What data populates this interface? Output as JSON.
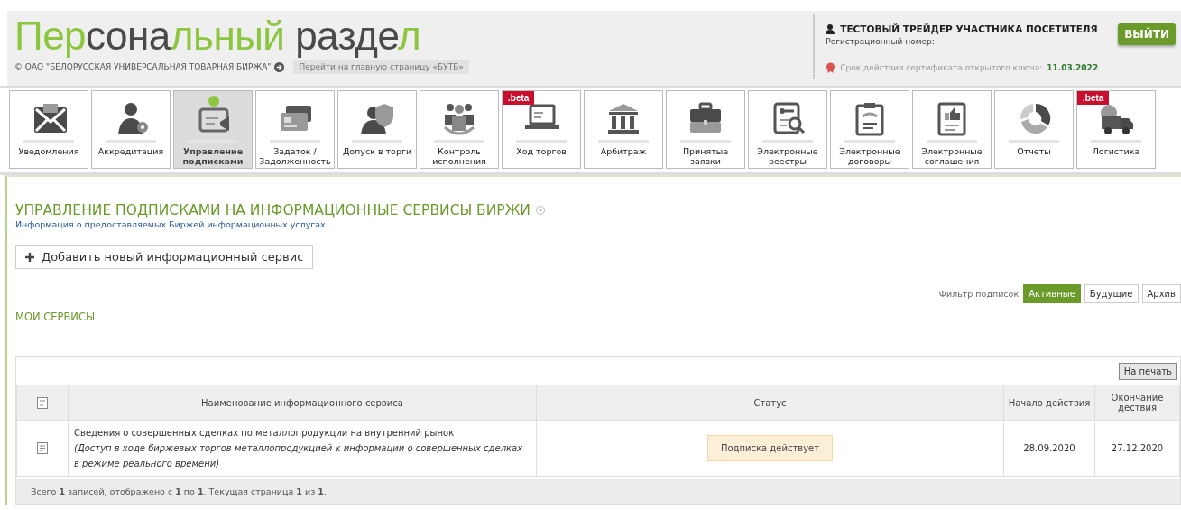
{
  "header": {
    "title": [
      {
        "text": "Пер",
        "accent": true
      },
      {
        "text": "сона",
        "accent": false
      },
      {
        "text": "льный",
        "accent": true
      },
      {
        "text": " разде",
        "accent": false
      },
      {
        "text": "л",
        "accent": true
      }
    ],
    "copyright": "© ОАО \"БЕЛОРУССКАЯ УНИВЕРСАЛЬНАЯ ТОВАРНАЯ БИРЖА\"",
    "home_link": "Перейти на главную страницу «БУТБ»"
  },
  "user": {
    "name": "ТЕСТОВЫЙ ТРЕЙДЕР УЧАСТНИКА ПОСЕТИТЕЛЯ",
    "reg_label": "Регистрационный номер:",
    "cert_label": "Срок действия сертификата открытого ключа:",
    "cert_date": "11.03.2022",
    "logout": "ВЫЙТИ"
  },
  "nav": [
    {
      "label": "Уведомления",
      "selected": false
    },
    {
      "label": "Аккредитация",
      "selected": false
    },
    {
      "label": "Управление подписками",
      "selected": true
    },
    {
      "label": "Задаток / Задолженность",
      "selected": false
    },
    {
      "label": "Допуск в торги",
      "selected": false
    },
    {
      "label": "Контроль исполнения",
      "selected": false
    },
    {
      "label": "Ход торгов",
      "selected": false,
      "badge": ".beta"
    },
    {
      "label": "Арбитраж",
      "selected": false
    },
    {
      "label": "Принятые заявки",
      "selected": false
    },
    {
      "label": "Электронные реестры",
      "selected": false
    },
    {
      "label": "Электронные договоры",
      "selected": false
    },
    {
      "label": "Электронные соглашения",
      "selected": false
    },
    {
      "label": "Отчеты",
      "selected": false
    },
    {
      "label": "Логистика",
      "selected": false,
      "badge": ".beta"
    }
  ],
  "page": {
    "title": "УПРАВЛЕНИЕ ПОДПИСКАМИ НА ИНФОРМАЦИОННЫЕ СЕРВИСЫ БИРЖИ",
    "subtitle": "Информация о предоставляемых Биржей информационных услугах",
    "add_button": "Добавить новый информационный сервис",
    "filter_label": "Фильтр подписок",
    "filters": [
      {
        "label": "Активные",
        "selected": true
      },
      {
        "label": "Будущие",
        "selected": false
      },
      {
        "label": "Архив",
        "selected": false
      }
    ],
    "section_title": "МОИ СЕРВИСЫ"
  },
  "table": {
    "print_button": "На печать",
    "columns": [
      "Наименование информационного сервиса",
      "Статус",
      "Начало действия",
      "Окончание дествия"
    ],
    "rows": [
      {
        "name": "Сведения о совершенных сделках по металлопродукции на внутренний рынок",
        "note": "(Доступ в ходе биржевых торгов металлопродукцией к информации о совершенных сделках в режиме реального времени)",
        "status": "Подписка действует",
        "start": "28.09.2020",
        "end": "27.12.2020"
      }
    ],
    "footer": "Всего **1** записей, отображено с **1** по **1**. Текущая страница **1** из **1**."
  }
}
